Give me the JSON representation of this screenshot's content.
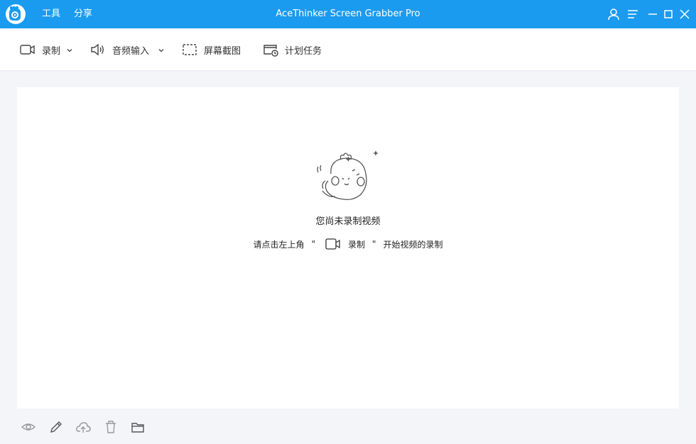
{
  "titlebar": {
    "app_title": "AceThinker Screen Grabber Pro",
    "menu": [
      "工具",
      "分享"
    ],
    "accent": "#1a9bf0"
  },
  "toolbar": {
    "record_label": "录制",
    "audio_label": "音频输入",
    "screenshot_label": "屏幕截图",
    "schedule_label": "计划任务"
  },
  "empty_state": {
    "title": "您尚未录制视频",
    "hint_prefix": "请点击左上角",
    "quote_open": "\"",
    "hint_record": "录制",
    "quote_close": "\"",
    "hint_suffix": "开始视频的录制"
  }
}
